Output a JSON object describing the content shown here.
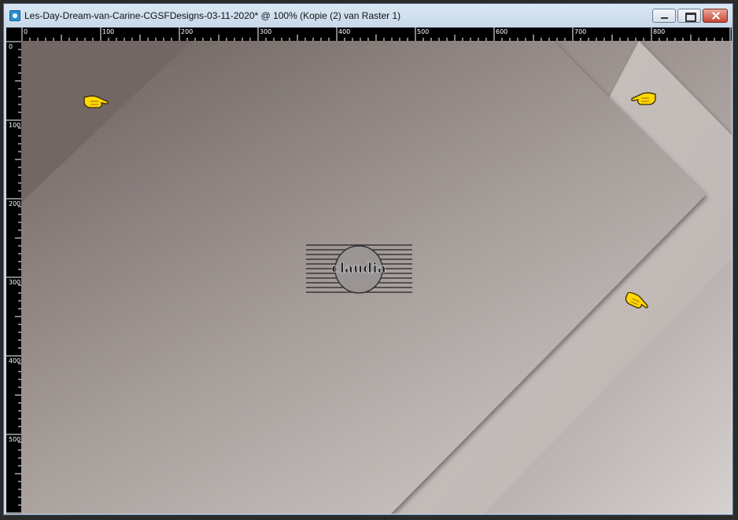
{
  "window": {
    "title": "Les-Day-Dream-van-Carine-CGSFDesigns-03-11-2020* @ 100% (Kopie (2) van Raster 1)"
  },
  "ruler": {
    "horizontal_labels": [
      "0",
      "100",
      "200",
      "300",
      "400",
      "500",
      "600",
      "700",
      "800"
    ],
    "vertical_labels": [
      "0",
      "100",
      "200",
      "300",
      "400",
      "500"
    ]
  },
  "watermark": {
    "text": "claudia"
  },
  "icons": {
    "app": "psp-icon",
    "pointer": "pointing-hand-icon"
  },
  "colors": {
    "canvas_dark": "#6b5f5b",
    "canvas_light": "#d2ccc9",
    "pointer_fill": "#ffd800"
  }
}
